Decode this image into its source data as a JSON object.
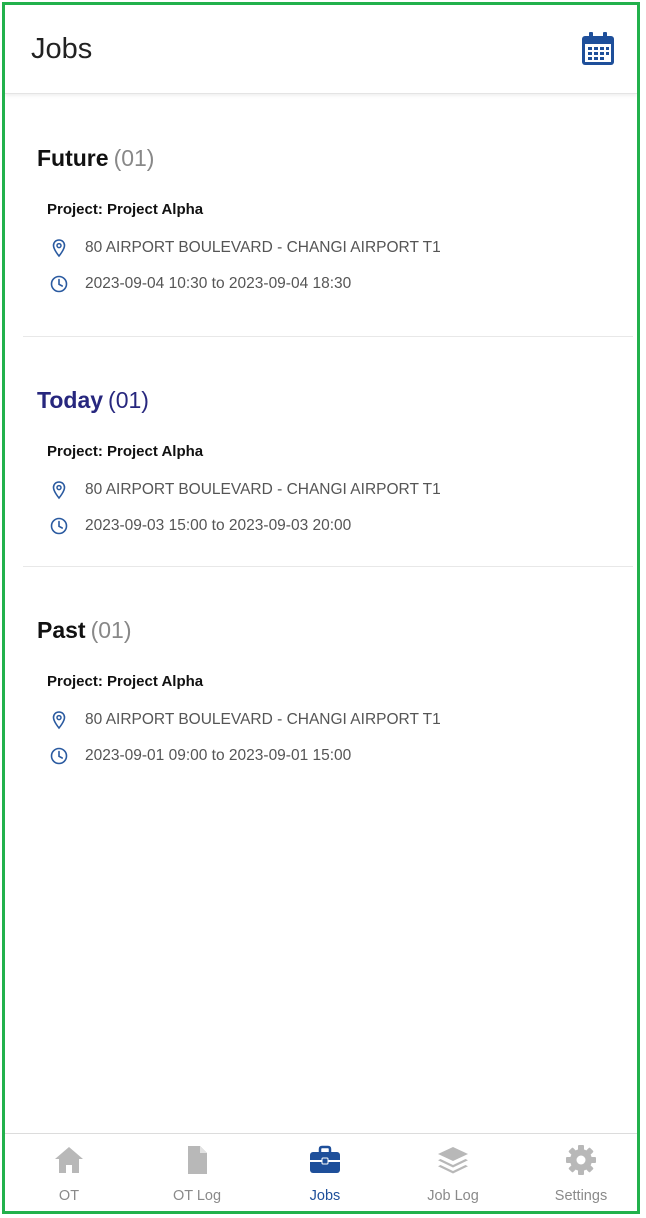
{
  "app_bar": {
    "title": "Jobs",
    "calendar_icon": "calendar-icon",
    "accent_color": "#1e4f9a"
  },
  "sections": [
    {
      "name": "Future",
      "count": "(01)",
      "jobs": [
        {
          "project": "Project: Project Alpha",
          "location": "80 AIRPORT BOULEVARD - CHANGI AIRPORT T1",
          "time": "2023-09-04 10:30 to 2023-09-04 18:30"
        }
      ]
    },
    {
      "name": "Today",
      "count": "(01)",
      "highlight_color": "#27277e",
      "jobs": [
        {
          "project": "Project: Project Alpha",
          "location": "80 AIRPORT BOULEVARD - CHANGI AIRPORT T1",
          "time": "2023-09-03 15:00 to 2023-09-03 20:00"
        }
      ]
    },
    {
      "name": "Past",
      "count": "(01)",
      "jobs": [
        {
          "project": "Project: Project Alpha",
          "location": "80 AIRPORT BOULEVARD - CHANGI AIRPORT T1",
          "time": "2023-09-01 09:00 to 2023-09-01 15:00"
        }
      ]
    }
  ],
  "bottom_nav": [
    {
      "label": "OT",
      "icon": "home-icon",
      "active": false
    },
    {
      "label": "OT Log",
      "icon": "document-icon",
      "active": false
    },
    {
      "label": "Jobs",
      "icon": "briefcase-icon",
      "active": true
    },
    {
      "label": "Job Log",
      "icon": "layers-icon",
      "active": false
    },
    {
      "label": "Settings",
      "icon": "gear-icon",
      "active": false
    }
  ],
  "colors": {
    "frame_border": "#22b14c",
    "nav_active": "#1e4f9a",
    "nav_inactive": "#b8b8b8"
  }
}
